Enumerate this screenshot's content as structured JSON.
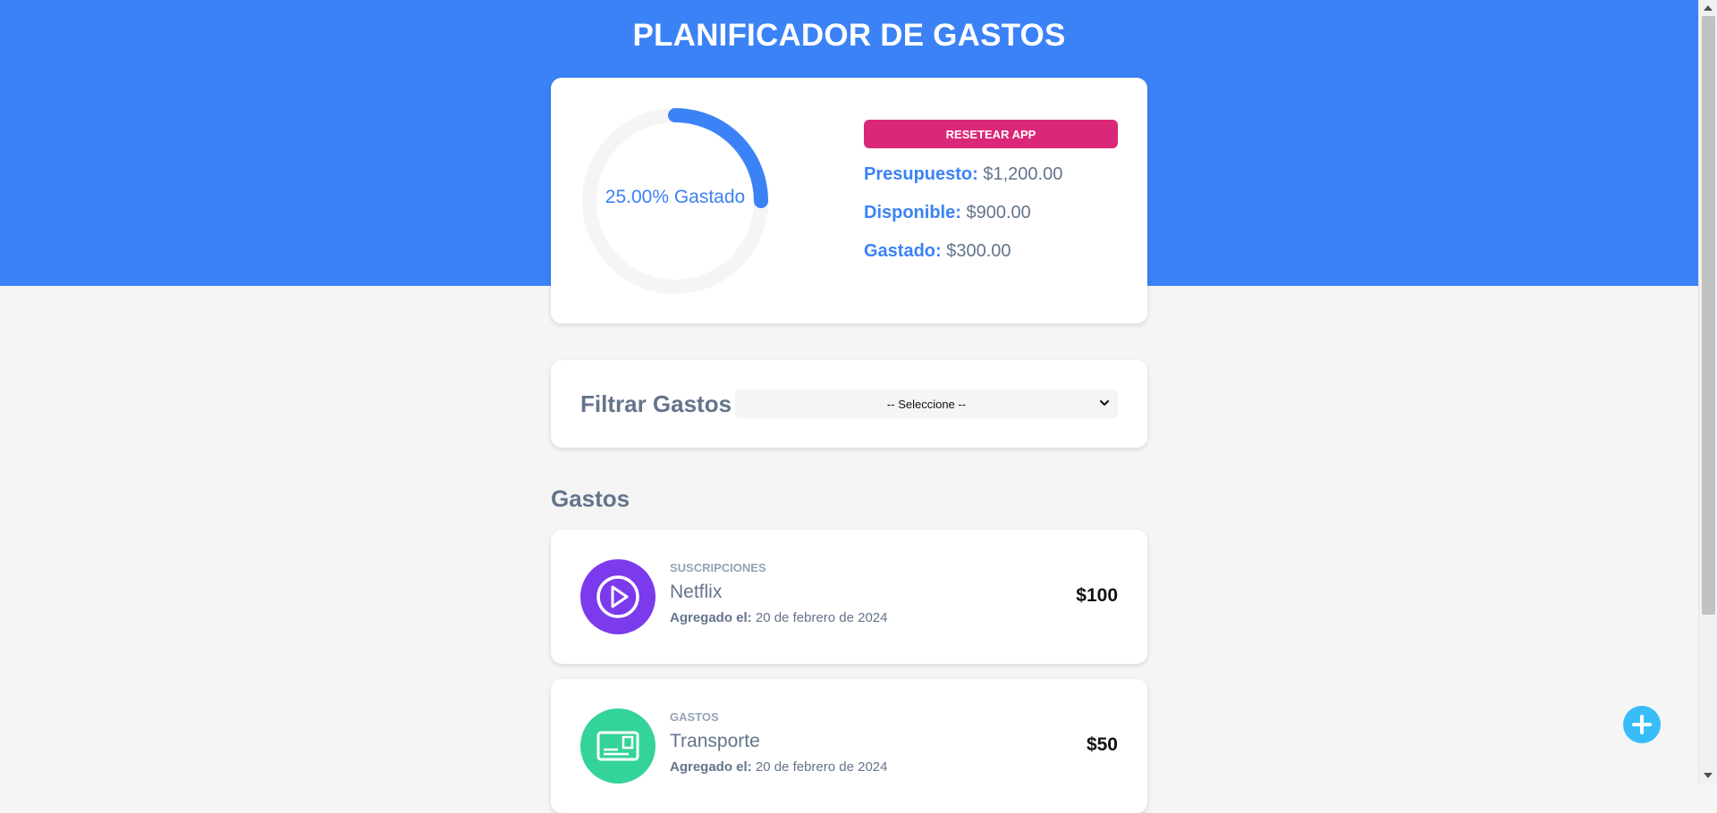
{
  "app": {
    "title": "PLANIFICADOR DE GASTOS"
  },
  "budget": {
    "progress_percent": 25,
    "progress_label": "25.00% Gastado",
    "reset_label": "RESETEAR APP",
    "presupuesto_label": "Presupuesto:",
    "presupuesto_value": "$1,200.00",
    "disponible_label": "Disponible:",
    "disponible_value": "$900.00",
    "gastado_label": "Gastado:",
    "gastado_value": "$300.00",
    "colors": {
      "progress": "#3b82f6",
      "track": "#f5f5f5",
      "reset": "#db2777"
    }
  },
  "filter": {
    "label": "Filtrar Gastos",
    "selected": "-- Seleccione --"
  },
  "expenses_section": {
    "title": "Gastos",
    "items": [
      {
        "category": "SUSCRIPCIONES",
        "name": "Netflix",
        "date_label": "Agregado el:",
        "date": "20 de febrero de 2024",
        "amount": "$100",
        "icon": "play-icon",
        "icon_color": "#7c3aed"
      },
      {
        "category": "GASTOS",
        "name": "Transporte",
        "date_label": "Agregado el:",
        "date": "20 de febrero de 2024",
        "amount": "$50",
        "icon": "card-icon",
        "icon_color": "#34d399"
      }
    ]
  },
  "fab": {
    "icon": "plus-icon",
    "color": "#38bdf8"
  }
}
